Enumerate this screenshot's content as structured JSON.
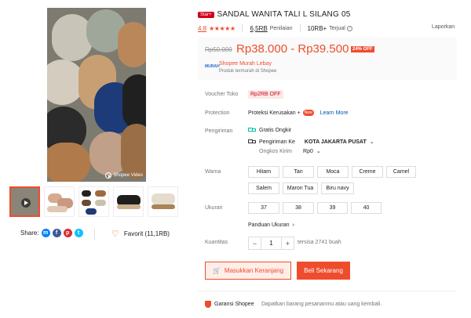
{
  "gallery": {
    "video_badge": "Shopee Video"
  },
  "share": {
    "label": "Share:"
  },
  "favorite": {
    "label": "Favorit (11,1RB)"
  },
  "product": {
    "badge": "Star+",
    "title": "SANDAL WANITA TALI L SILANG 05",
    "rating": "4.8",
    "stars": "★★★★★",
    "ratings_count": "6,5RB",
    "ratings_label": "Penilaian",
    "sold_count": "10RB+",
    "sold_label": "Terjual",
    "report": "Laporkan"
  },
  "price": {
    "original": "Rp50.000",
    "range": "Rp38.000 - Rp39.500",
    "discount": "24% OFF",
    "murah_logo": "MURAH",
    "murah_label": "Shopee Murah Lebay",
    "murah_sub": "Produk termurah di Shopee"
  },
  "voucher": {
    "label": "Voucher Toko",
    "value": "Rp2RB OFF"
  },
  "protection": {
    "label": "Protection",
    "value": "Proteksi Kerusakan +",
    "new": "New",
    "link": "Learn More"
  },
  "shipping": {
    "label": "Pengiriman",
    "free": "Gratis Ongkir",
    "to_label": "Pengiriman Ke",
    "to_value": "KOTA JAKARTA PUSAT",
    "cost_label": "Ongkos Kirim",
    "cost_value": "Rp0"
  },
  "colors": {
    "label": "Warna",
    "options": [
      "Hitam",
      "Tan",
      "Moca",
      "Creme",
      "Camel",
      "Salem",
      "Maron Tua",
      "Biru navy"
    ]
  },
  "sizes": {
    "label": "Ukuran",
    "options": [
      "37",
      "38",
      "39",
      "40"
    ],
    "guide": "Panduan Ukuran"
  },
  "quantity": {
    "label": "Kuantitas",
    "minus": "−",
    "value": "1",
    "plus": "+",
    "stock": "tersisa 2741 buah"
  },
  "actions": {
    "cart": "Masukkan Keranjang",
    "buy": "Beli Sekarang"
  },
  "guarantee": {
    "title": "Garansi Shopee",
    "desc": "Dapatkan barang pesananmu atau uang kembali."
  },
  "theme": {
    "accent": "#ee4d2d"
  }
}
